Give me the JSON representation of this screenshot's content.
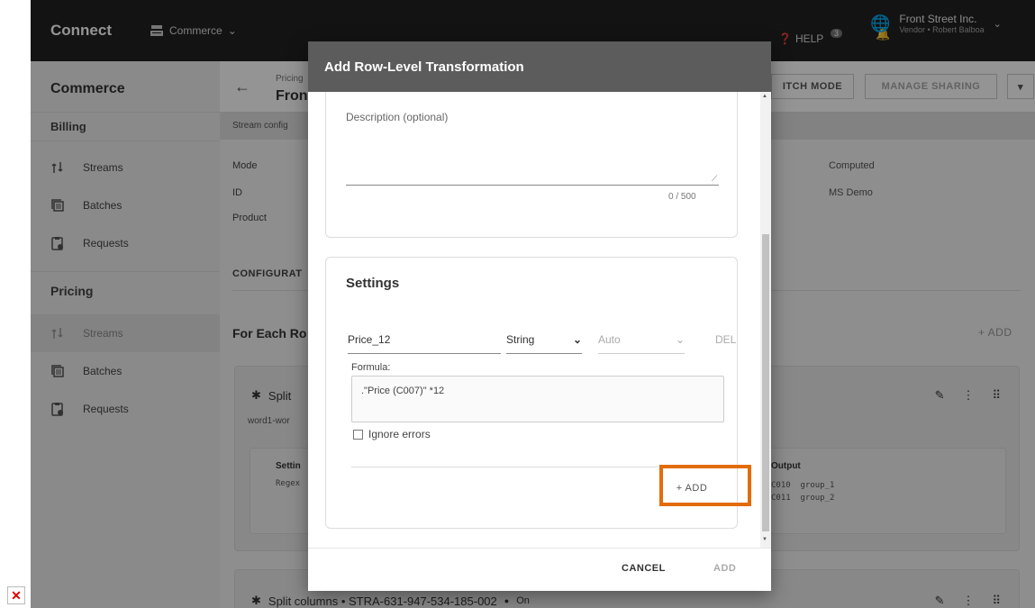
{
  "topbar": {
    "brand": "Connect",
    "app_switcher": "Commerce",
    "help": "HELP",
    "notification_count": "3",
    "account_org": "Front Street Inc.",
    "account_sub": "Vendor • Robert Balboa"
  },
  "sidebar": {
    "title": "Commerce",
    "billing": {
      "heading": "Billing",
      "items": [
        {
          "label": "Streams",
          "icon": "streams-icon"
        },
        {
          "label": "Batches",
          "icon": "batches-icon"
        },
        {
          "label": "Requests",
          "icon": "requests-icon"
        }
      ]
    },
    "pricing": {
      "heading": "Pricing",
      "items": [
        {
          "label": "Streams",
          "icon": "streams-icon",
          "active": true
        },
        {
          "label": "Batches",
          "icon": "batches-icon"
        },
        {
          "label": "Requests",
          "icon": "requests-icon"
        }
      ]
    }
  },
  "main": {
    "breadcrumb": "Pricing",
    "title": "Fron",
    "switch_mode": "ITCH MODE",
    "manage_sharing": "MANAGE SHARING",
    "subbar": "Stream config",
    "mode_key": "Mode",
    "mode_val": "Computed",
    "id_key": "ID",
    "id_val": "MS Demo",
    "product_key": "Product",
    "config_label": "CONFIGURAT",
    "for_each": "For Each Ro",
    "add": "+ ADD",
    "card1": {
      "title": "Split",
      "sub": "word1-wor",
      "settings_label": "Settin",
      "regex": "Regex",
      "output_label": "Output",
      "output_lines": "C010  group_1\nC011  group_2"
    },
    "card2": {
      "title": "Split columns • STRA-631-947-534-185-002",
      "status": "On"
    }
  },
  "dialog": {
    "title": "Add Row-Level Transformation",
    "description_label": "Description (optional)",
    "description_counter": "0 / 500",
    "settings_title": "Settings",
    "column_name": "Price_12",
    "column_type": "String",
    "auto_placeholder": "Auto",
    "delete_label": "DEL",
    "formula_label": "Formula:",
    "formula_value": ".\"Price (C007)\" *12",
    "ignore_errors": "Ignore errors",
    "add_button": "+ ADD",
    "cancel": "CANCEL",
    "submit": "ADD"
  },
  "colors": {
    "topbar": "#212121",
    "dialog_header": "#5c5c5c",
    "highlight": "#e36c09"
  }
}
